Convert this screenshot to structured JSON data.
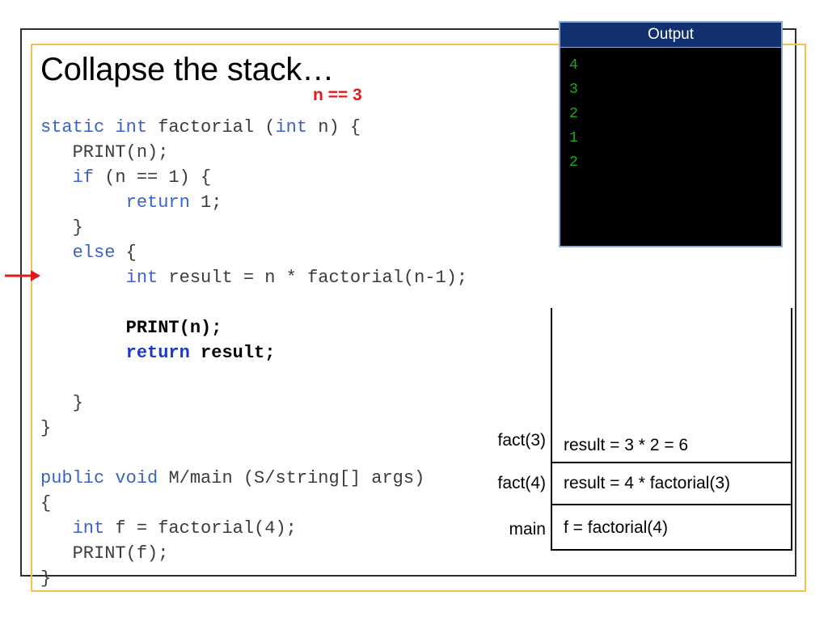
{
  "slide": {
    "title": "Collapse the stack…",
    "annotation": "n == 3",
    "frame_color": "#2e2e2e",
    "accent_color": "#f2c14e",
    "arrow_color": "#e01b1b"
  },
  "code": {
    "lines": [
      [
        {
          "t": "static ",
          "s": "kw"
        },
        {
          "t": "int ",
          "s": "kw"
        },
        {
          "t": "factorial (",
          "s": ""
        },
        {
          "t": "int",
          "s": "kw"
        },
        {
          "t": " n) {",
          "s": ""
        }
      ],
      [
        {
          "t": "   PRINT(n);",
          "s": ""
        }
      ],
      [
        {
          "t": "   ",
          "s": ""
        },
        {
          "t": "if",
          "s": "kw"
        },
        {
          "t": " (n == 1) {",
          "s": ""
        }
      ],
      [
        {
          "t": "        ",
          "s": ""
        },
        {
          "t": "return",
          "s": "kw"
        },
        {
          "t": " 1;",
          "s": ""
        }
      ],
      [
        {
          "t": "   }",
          "s": ""
        }
      ],
      [
        {
          "t": "   ",
          "s": ""
        },
        {
          "t": "else",
          "s": "kw"
        },
        {
          "t": " {",
          "s": ""
        }
      ],
      [
        {
          "t": "        ",
          "s": ""
        },
        {
          "t": "int",
          "s": "kw"
        },
        {
          "t": " result = n * factorial(n-1);",
          "s": ""
        }
      ],
      [
        {
          "t": "",
          "s": ""
        }
      ],
      [
        {
          "t": "        ",
          "s": ""
        },
        {
          "t": "PRINT(n);",
          "s": "b"
        }
      ],
      [
        {
          "t": "        ",
          "s": ""
        },
        {
          "t": "return",
          "s": "kwb"
        },
        {
          "t": " ",
          "s": ""
        },
        {
          "t": "result;",
          "s": "b"
        }
      ],
      [
        {
          "t": "",
          "s": ""
        }
      ],
      [
        {
          "t": "   }",
          "s": ""
        }
      ],
      [
        {
          "t": "}",
          "s": ""
        }
      ],
      [
        {
          "t": "",
          "s": ""
        }
      ],
      [
        {
          "t": "public ",
          "s": "kw"
        },
        {
          "t": "void ",
          "s": "kw"
        },
        {
          "t": "M/main (S/string[] args)",
          "s": ""
        }
      ],
      [
        {
          "t": "{",
          "s": ""
        }
      ],
      [
        {
          "t": "   ",
          "s": ""
        },
        {
          "t": "int",
          "s": "kw"
        },
        {
          "t": " f = factorial(4);",
          "s": ""
        }
      ],
      [
        {
          "t": "   PRINT(f);",
          "s": ""
        }
      ],
      [
        {
          "t": "}",
          "s": ""
        }
      ]
    ]
  },
  "output": {
    "title": "Output",
    "lines": [
      "4",
      "3",
      "2",
      "1",
      "2"
    ],
    "text_color": "#1faa1f",
    "background": "#000000",
    "titlebar_color": "#12306e"
  },
  "call_stack": {
    "frames": [
      {
        "label": "fact(3)",
        "body": "result = 3 * 2 = 6"
      },
      {
        "label": "fact(4)",
        "body": "result = 4 * factorial(3)"
      },
      {
        "label": "main",
        "body": "f = factorial(4)"
      }
    ]
  }
}
